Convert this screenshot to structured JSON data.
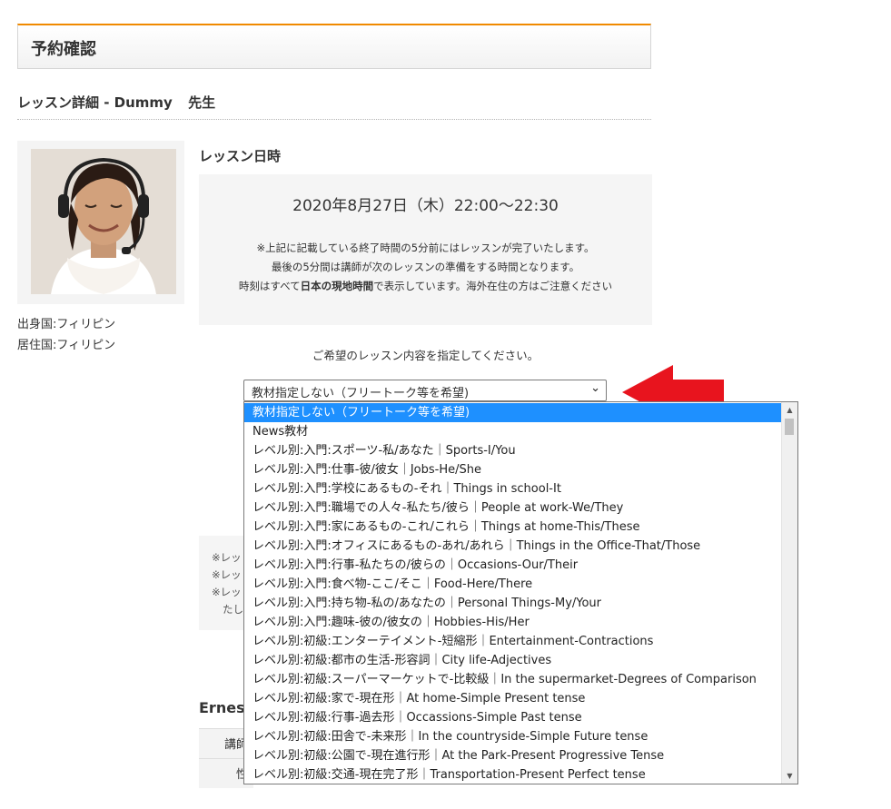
{
  "header": {
    "title": "予約確認"
  },
  "lesson_detail": {
    "prefix": "レッスン詳細 - ",
    "teacher_name": "Dummy",
    "suffix": "先生"
  },
  "teacher": {
    "origin": "出身国:フィリピン",
    "residence": "居住国:フィリピン"
  },
  "lesson_datetime": {
    "title": "レッスン日時",
    "date": "2020年8月27日（木）22:00～22:30",
    "note1": "※上記に記載している終了時間の5分前にはレッスンが完了いたします。",
    "note2": "最後の5分間は講師が次のレッスンの準備をする時間となります。",
    "note3_pre": "時刻はすべて",
    "note3_bold": "日本の現地時間",
    "note3_post": "で表示しています。海外在住の方はご注意ください"
  },
  "instruction": "ご希望のレッスン内容を指定してください。",
  "material_select": {
    "selected": "教材指定しない（フリートーク等を希望)",
    "options": [
      "教材指定しない（フリートーク等を希望)",
      "News教材",
      "レベル別:入門:スポーツ-私/あなた｜Sports-I/You",
      "レベル別:入門:仕事-彼/彼女｜Jobs-He/She",
      "レベル別:入門:学校にあるもの-それ｜Things in school-It",
      "レベル別:入門:職場での人々-私たち/彼ら｜People at work-We/They",
      "レベル別:入門:家にあるもの-これ/これら｜Things at home-This/These",
      "レベル別:入門:オフィスにあるもの-あれ/あれら｜Things in the Office-That/Those",
      "レベル別:入門:行事-私たちの/彼らの｜Occasions-Our/Their",
      "レベル別:入門:食べ物-ここ/そこ｜Food-Here/There",
      "レベル別:入門:持ち物-私の/あなたの｜Personal Things-My/Your",
      "レベル別:入門:趣味-彼の/彼女の｜Hobbies-His/Her",
      "レベル別:初級:エンターテイメント-短縮形｜Entertainment-Contractions",
      "レベル別:初級:都市の生活-形容詞｜City life-Adjectives",
      "レベル別:初級:スーパーマーケットで-比較級｜In the supermarket-Degrees of Comparison",
      "レベル別:初級:家で-現在形｜At home-Simple Present tense",
      "レベル別:初級:行事-過去形｜Occassions-Simple Past tense",
      "レベル別:初級:田舎で-未来形｜In the countryside-Simple Future tense",
      "レベル別:初級:公園で-現在進行形｜At the Park-Present Progressive Tense",
      "レベル別:初級:交通-現在完了形｜Transportation-Present Perfect tense"
    ]
  },
  "partially_hidden": {
    "notes": [
      "※レッ",
      "※レッ",
      "※レッ",
      "たし"
    ],
    "profile_title": "Ernes",
    "table_labels": [
      "講師",
      "性"
    ]
  },
  "colors": {
    "accent_orange": "#f08a00",
    "highlight_blue": "#1e90ff",
    "arrow_red": "#e8141e"
  },
  "icons": {
    "select_arrow": "chevron-down-icon",
    "callout": "red-arrow-icon"
  }
}
